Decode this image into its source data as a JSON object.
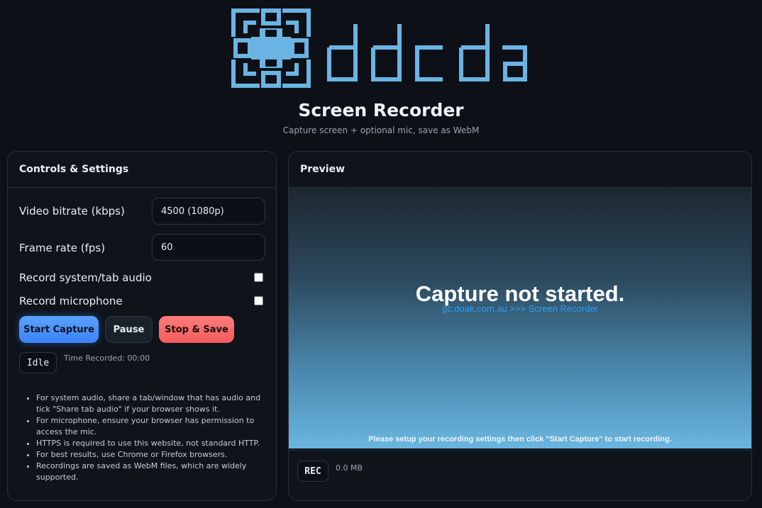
{
  "brand": {
    "name": "ddcda",
    "color": "#6ab4e4"
  },
  "header": {
    "title": "Screen Recorder",
    "subtitle": "Capture screen + optional mic, save as WebM"
  },
  "controls": {
    "heading": "Controls & Settings",
    "video_bitrate": {
      "label": "Video bitrate (kbps)",
      "value": "4500 (1080p)"
    },
    "frame_rate": {
      "label": "Frame rate (fps)",
      "value": "60"
    },
    "system_audio": {
      "label": "Record system/tab audio",
      "checked": false
    },
    "microphone": {
      "label": "Record microphone",
      "checked": false
    },
    "buttons": {
      "start": "Start Capture",
      "pause": "Pause",
      "stop": "Stop & Save"
    },
    "status": "Idle",
    "time_recorded": "Time Recorded: 00:00",
    "notes": [
      "For system audio, share a tab/window that has audio and tick \"Share tab audio\" if your browser shows it.",
      "For microphone, ensure your browser has permission to access the mic.",
      "HTTPS is required to use this website, not standard HTTP.",
      "For best results, use Chrome or Firefox browsers.",
      "Recordings are saved as WebM files, which are widely supported."
    ]
  },
  "preview": {
    "heading": "Preview",
    "title": "Capture not started.",
    "link": "gc.doak.com.au >>> Screen Recorder",
    "hint": "Please setup your recording settings then click \"Start Capture\" to start recording.",
    "rec_label": "REC",
    "file_size": "0.0 MB"
  },
  "colors": {
    "background": "#0d1117",
    "accent_blue": "#3b82f6",
    "stop_red": "#f25c5c",
    "link": "#2f9ff5"
  }
}
